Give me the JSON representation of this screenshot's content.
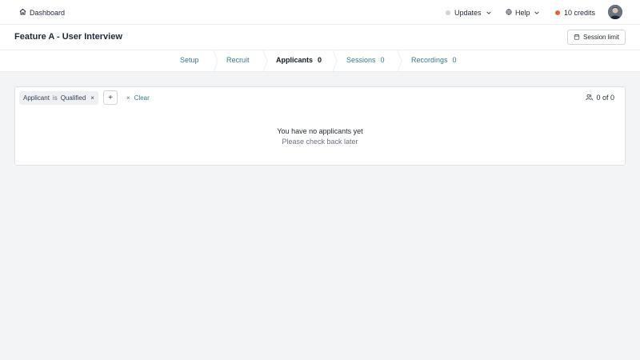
{
  "topbar": {
    "dashboard_label": "Dashboard",
    "updates_label": "Updates",
    "help_label": "Help",
    "credits_label": "10 credits",
    "credits_dot_color": "#e0643b",
    "updates_dot_color": "#d1d5db"
  },
  "header": {
    "title": "Feature A - User Interview",
    "session_limit_label": "Session limit"
  },
  "tabs": [
    {
      "label": "Setup",
      "count": ""
    },
    {
      "label": "Recruit",
      "count": ""
    },
    {
      "label": "Applicants",
      "count": "0",
      "active": true
    },
    {
      "label": "Sessions",
      "count": "0"
    },
    {
      "label": "Recordings",
      "count": "0"
    }
  ],
  "filter": {
    "field": "Applicant",
    "operator": "is",
    "value": "Qualified",
    "remove_symbol": "×",
    "add_symbol": "+",
    "clear_symbol": "×",
    "clear_label": "Clear"
  },
  "results": {
    "count_label": "0 of 0",
    "empty_title": "You have no applicants yet",
    "empty_subtitle": "Please check back later"
  },
  "colors": {
    "accent": "#3b7a8a",
    "background": "#f3f4f6"
  }
}
